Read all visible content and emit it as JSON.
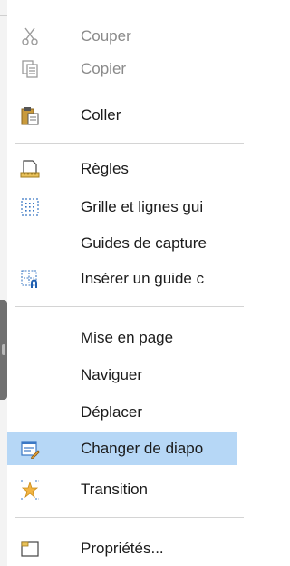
{
  "menu": {
    "items": [
      {
        "id": "cut",
        "label": "Couper",
        "icon": "scissors-icon",
        "enabled": false,
        "highlighted": false
      },
      {
        "id": "copy",
        "label": "Copier",
        "icon": "copy-icon",
        "enabled": false,
        "highlighted": false
      },
      {
        "id": "paste",
        "label": "Coller",
        "icon": "clipboard-paste-icon",
        "enabled": true,
        "highlighted": false
      },
      {
        "id": "rulers",
        "label": "Règles",
        "icon": "ruler-icon",
        "enabled": true,
        "highlighted": false
      },
      {
        "id": "grid",
        "label": "Grille et lignes gui",
        "icon": "grid-icon",
        "enabled": true,
        "highlighted": false
      },
      {
        "id": "snap",
        "label": "Guides de capture",
        "icon": "",
        "enabled": true,
        "highlighted": false
      },
      {
        "id": "insert_guide",
        "label": "Insérer un guide c",
        "icon": "insert-guide-icon",
        "enabled": true,
        "highlighted": false
      },
      {
        "id": "layout",
        "label": "Mise en page",
        "icon": "",
        "enabled": true,
        "highlighted": false
      },
      {
        "id": "navigate",
        "label": "Naviguer",
        "icon": "",
        "enabled": true,
        "highlighted": false
      },
      {
        "id": "move",
        "label": "Déplacer",
        "icon": "",
        "enabled": true,
        "highlighted": false
      },
      {
        "id": "change_slide",
        "label": "Changer de diapo",
        "icon": "slide-layout-icon",
        "enabled": true,
        "highlighted": true
      },
      {
        "id": "transition",
        "label": "Transition",
        "icon": "transition-star-icon",
        "enabled": true,
        "highlighted": false
      },
      {
        "id": "properties",
        "label": "Propriétés...",
        "icon": "properties-icon",
        "enabled": true,
        "highlighted": false
      }
    ]
  },
  "colors": {
    "highlight": "#b6d7f6",
    "disabled_text": "#8a8a8a",
    "separator": "#d4d4d4"
  }
}
